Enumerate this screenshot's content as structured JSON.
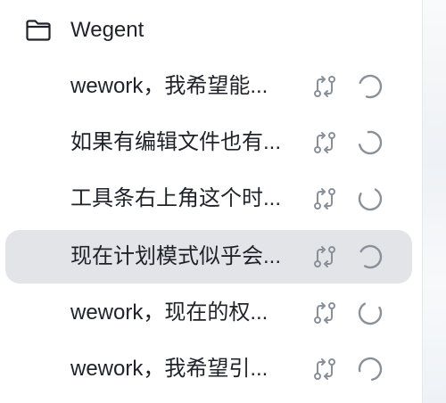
{
  "folder": {
    "icon": "folder-icon",
    "label": "Wegent"
  },
  "items": [
    {
      "title": "wework，我希望能...",
      "status_icon": "git-compare-icon",
      "progress_icon": "loading-spinner-icon",
      "active": false
    },
    {
      "title": "如果有编辑文件也有...",
      "status_icon": "git-compare-icon",
      "progress_icon": "loading-spinner-icon",
      "active": false
    },
    {
      "title": "工具条右上角这个时...",
      "status_icon": "git-compare-icon",
      "progress_icon": "loading-spinner-icon",
      "active": false
    },
    {
      "title": "现在计划模式似乎会...",
      "status_icon": "git-compare-icon",
      "progress_icon": "loading-spinner-icon",
      "active": true
    },
    {
      "title": "wework，现在的权...",
      "status_icon": "git-compare-icon",
      "progress_icon": "loading-spinner-icon",
      "active": false
    },
    {
      "title": "wework，我希望引...",
      "status_icon": "git-compare-icon",
      "progress_icon": "loading-spinner-icon",
      "active": false
    }
  ],
  "colors": {
    "text": "#1f2329",
    "icon": "#8a9099",
    "active_bg": "#e2e4e8"
  }
}
